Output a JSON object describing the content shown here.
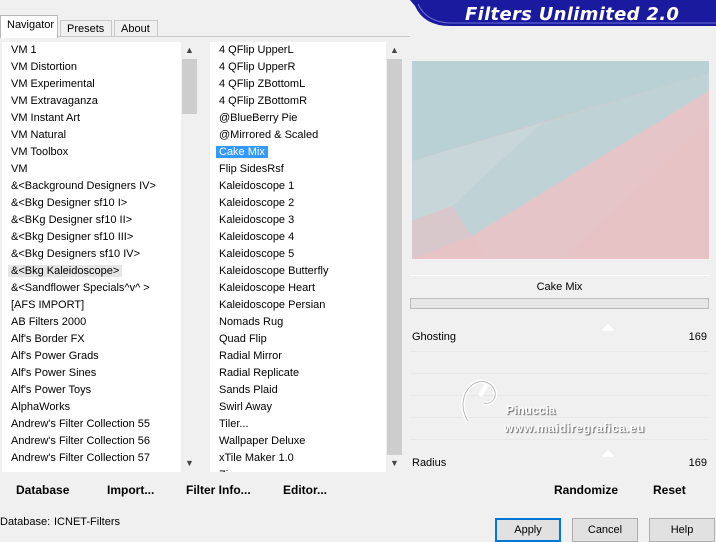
{
  "tabs": [
    {
      "label": "Navigator",
      "active": true
    },
    {
      "label": "Presets",
      "active": false
    },
    {
      "label": "About",
      "active": false
    }
  ],
  "banner": {
    "title": "Filters Unlimited 2.0",
    "color": "#1a1a9e"
  },
  "category_list": {
    "items": [
      "VM 1",
      "VM Distortion",
      "VM Experimental",
      "VM Extravaganza",
      "VM Instant Art",
      "VM Natural",
      "VM Toolbox",
      "VM",
      "&<Background Designers IV>",
      "&<Bkg Designer sf10 I>",
      "&<BKg Designer sf10 II>",
      "&<Bkg Designer sf10 III>",
      "&<Bkg Designers sf10 IV>",
      "&<Bkg Kaleidoscope>",
      "&<Sandflower Specials^v^ >",
      "[AFS IMPORT]",
      "AB Filters 2000",
      "Alf's Border FX",
      "Alf's Power Grads",
      "Alf's Power Sines",
      "Alf's Power Toys",
      "AlphaWorks",
      "Andrew's Filter Collection 55",
      "Andrew's Filter Collection 56",
      "Andrew's Filter Collection 57"
    ],
    "selected_index": 13,
    "highlight_color": "#e5e5e5"
  },
  "filter_list": {
    "items": [
      "4 QFlip UpperL",
      "4 QFlip UpperR",
      "4 QFlip ZBottomL",
      "4 QFlip ZBottomR",
      "@BlueBerry Pie",
      "@Mirrored & Scaled",
      "Cake Mix",
      "Flip SidesRsf",
      "Kaleidoscope 1",
      "Kaleidoscope 2",
      "Kaleidoscope 3",
      "Kaleidoscope 4",
      "Kaleidoscope 5",
      "Kaleidoscope Butterfly",
      "Kaleidoscope Heart",
      "Kaleidoscope Persian",
      "Nomads Rug",
      "Quad Flip",
      "Radial Mirror",
      "Radial Replicate",
      "Sands Plaid",
      "Swirl Away",
      "Tiler...",
      "Wallpaper Deluxe",
      "xTile Maker 1.0",
      "Zipper"
    ],
    "selected_index": 6
  },
  "preview": {
    "colors": {
      "pink": "#e8c3c5",
      "blue": "#b9d0d4"
    }
  },
  "filter_name": "Cake Mix",
  "progress": 0,
  "sliders": [
    {
      "label": "Ghosting",
      "value": "169",
      "level": 0.663
    },
    {
      "label": "Radius",
      "value": "169",
      "level": 0.663
    }
  ],
  "watermark": {
    "line1": "Pinuccia",
    "line2": "www.maidiregrafica.eu"
  },
  "bottom_buttons": {
    "database": "Database",
    "import": "Import...",
    "filter_info": "Filter Info...",
    "editor": "Editor...",
    "randomize": "Randomize",
    "reset": "Reset"
  },
  "status": {
    "label": "Database:",
    "value": "ICNET-Filters"
  },
  "dialog_buttons": {
    "apply": "Apply",
    "cancel": "Cancel",
    "help": "Help"
  }
}
